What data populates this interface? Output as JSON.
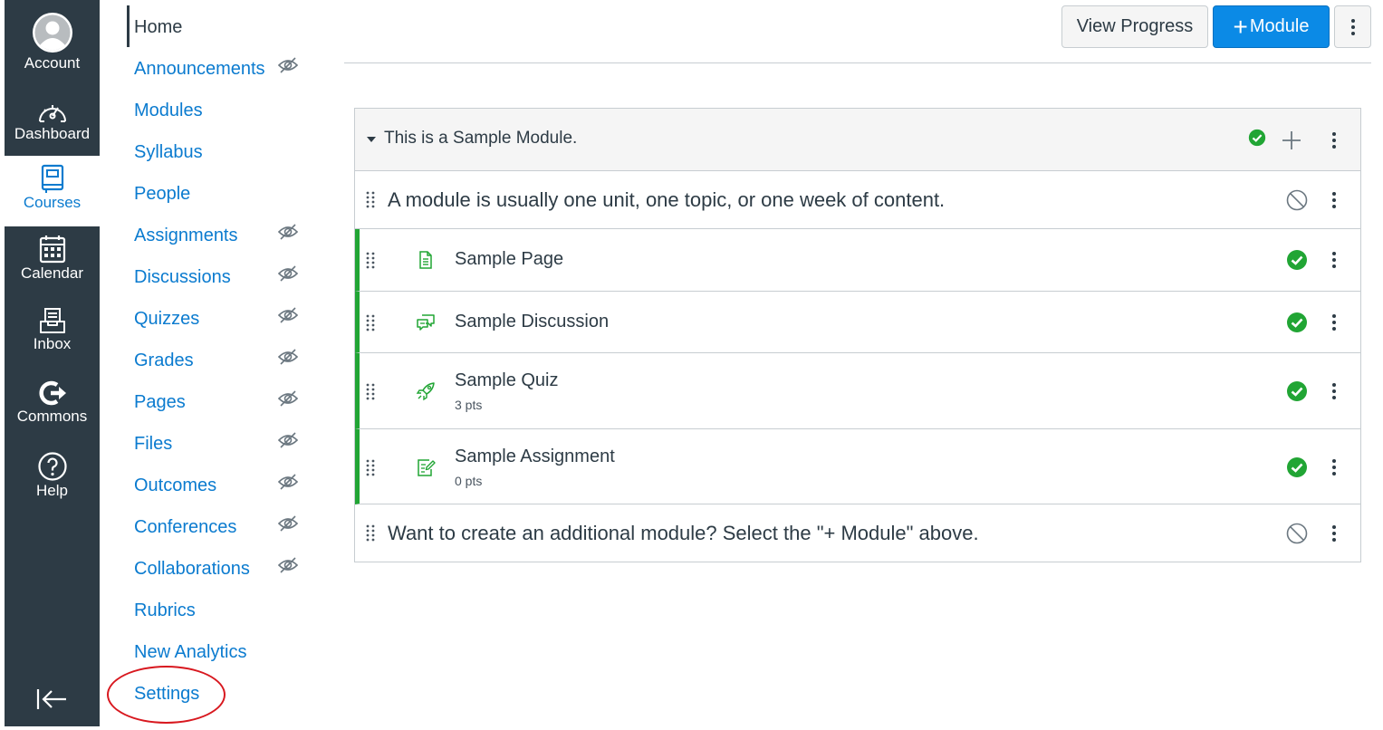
{
  "global_nav": {
    "items": [
      {
        "label": "Account",
        "icon": "user-avatar-icon"
      },
      {
        "label": "Dashboard",
        "icon": "dashboard-gauge-icon"
      },
      {
        "label": "Courses",
        "icon": "book-icon",
        "active": true
      },
      {
        "label": "Calendar",
        "icon": "calendar-icon"
      },
      {
        "label": "Inbox",
        "icon": "inbox-icon"
      },
      {
        "label": "Commons",
        "icon": "commons-arrow-icon"
      },
      {
        "label": "Help",
        "icon": "help-question-icon"
      }
    ],
    "collapse_icon": "collapse-arrow-icon"
  },
  "course_nav": {
    "items": [
      {
        "label": "Home",
        "current": true,
        "hidden": false
      },
      {
        "label": "Announcements",
        "hidden": true
      },
      {
        "label": "Modules",
        "hidden": false
      },
      {
        "label": "Syllabus",
        "hidden": false
      },
      {
        "label": "People",
        "hidden": false
      },
      {
        "label": "Assignments",
        "hidden": true
      },
      {
        "label": "Discussions",
        "hidden": true
      },
      {
        "label": "Quizzes",
        "hidden": true
      },
      {
        "label": "Grades",
        "hidden": true
      },
      {
        "label": "Pages",
        "hidden": true
      },
      {
        "label": "Files",
        "hidden": true
      },
      {
        "label": "Outcomes",
        "hidden": true
      },
      {
        "label": "Conferences",
        "hidden": true
      },
      {
        "label": "Collaborations",
        "hidden": true
      },
      {
        "label": "Rubrics",
        "hidden": false
      },
      {
        "label": "New Analytics",
        "hidden": false
      },
      {
        "label": "Settings",
        "hidden": false,
        "highlighted": true
      }
    ]
  },
  "toolbar": {
    "view_progress_label": "View Progress",
    "module_label": "Module",
    "module_plus": "+"
  },
  "module": {
    "title": "This is a Sample Module.",
    "published": true,
    "rows": [
      {
        "kind": "header",
        "title": "A module is usually one unit, one topic, or one week of content.",
        "published": false
      },
      {
        "kind": "item",
        "type": "page-icon",
        "title": "Sample Page",
        "points": "",
        "published": true
      },
      {
        "kind": "item",
        "type": "discussion-icon",
        "title": "Sample Discussion",
        "points": "",
        "published": true
      },
      {
        "kind": "item",
        "type": "quiz-rocket-icon",
        "title": "Sample Quiz",
        "points": "3 pts",
        "published": true
      },
      {
        "kind": "item",
        "type": "assignment-icon",
        "title": "Sample Assignment",
        "points": "0 pts",
        "published": true
      },
      {
        "kind": "header",
        "title": "Want to create an additional module? Select the \"+ Module\" above.",
        "published": false
      }
    ]
  },
  "colors": {
    "nav_bg": "#2d3b45",
    "link_blue": "#0b7bcf",
    "primary_button": "#0b8ae6",
    "published_green": "#21a534",
    "highlight_ring": "#d8181f"
  }
}
